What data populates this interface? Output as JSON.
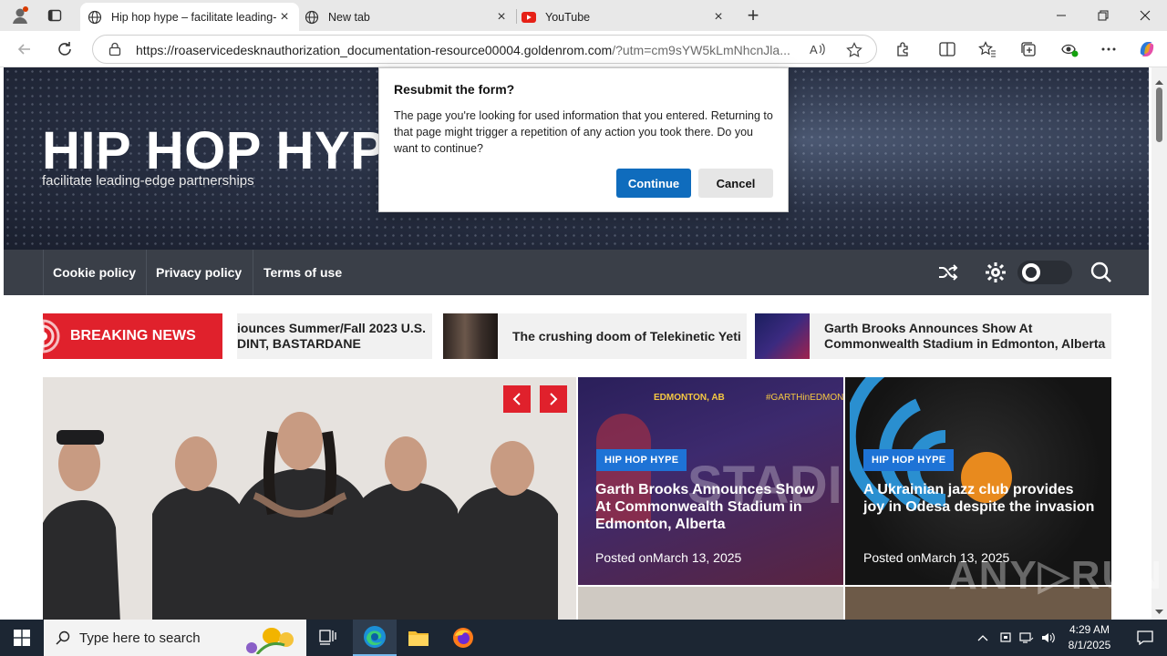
{
  "browser": {
    "tabs": [
      {
        "title": "Hip hop hype – facilitate leading-",
        "icon": "globe-icon",
        "active": true
      },
      {
        "title": "New tab",
        "icon": "globe-icon",
        "active": false
      },
      {
        "title": "YouTube",
        "icon": "youtube-icon",
        "active": false
      }
    ],
    "url_main": "https://roaservicedesknauthorization_documentation-resource00004.goldenrom.com",
    "url_rest": "/?utm=cm9sYW5kLmNhcnJla..."
  },
  "site": {
    "title": "HIP HOP HYPE",
    "tagline": "facilitate leading-edge partnerships",
    "nav": [
      "Cookie policy",
      "Privacy policy",
      "Terms of use"
    ]
  },
  "breaking": {
    "label": "BREAKING NEWS",
    "items": [
      {
        "line1": "iounces Summer/Fall 2023 U.S.",
        "line2": "DINT, BASTARDANE"
      },
      {
        "line1": "The crushing doom of Telekinetic Yeti",
        "line2": ""
      },
      {
        "line1": "Garth Brooks Announces Show At",
        "line2": "Commonwealth Stadium in Edmonton, Alberta"
      }
    ]
  },
  "cards": [
    {
      "badge": "HIP HOP HYPE",
      "title": "Garth Brooks Announces Show At Commonwealth Stadium in Edmonton, Alberta",
      "date": "Posted onMarch 13, 2025",
      "overlay_top": "EDMONTON, AB",
      "overlay_tag": "#GARTHinEDMONT"
    },
    {
      "badge": "HIP HOP HYPE",
      "title": "A Ukrainian jazz club provides joy in Odesa despite the invasion",
      "date": "Posted onMarch 13, 2025"
    }
  ],
  "dialog": {
    "title": "Resubmit the form?",
    "body": "The page you're looking for used information that you entered. Returning to that page might trigger a repetition of any action you took there. Do you want to continue?",
    "continue": "Continue",
    "cancel": "Cancel"
  },
  "taskbar": {
    "search_placeholder": "Type here to search",
    "time": "4:29 AM",
    "date": "8/1/2025"
  },
  "colors": {
    "accent_red": "#e0212c",
    "badge_blue": "#1e73d6",
    "dialog_blue": "#0f6cbd",
    "nav_bg": "#3a3f48"
  }
}
